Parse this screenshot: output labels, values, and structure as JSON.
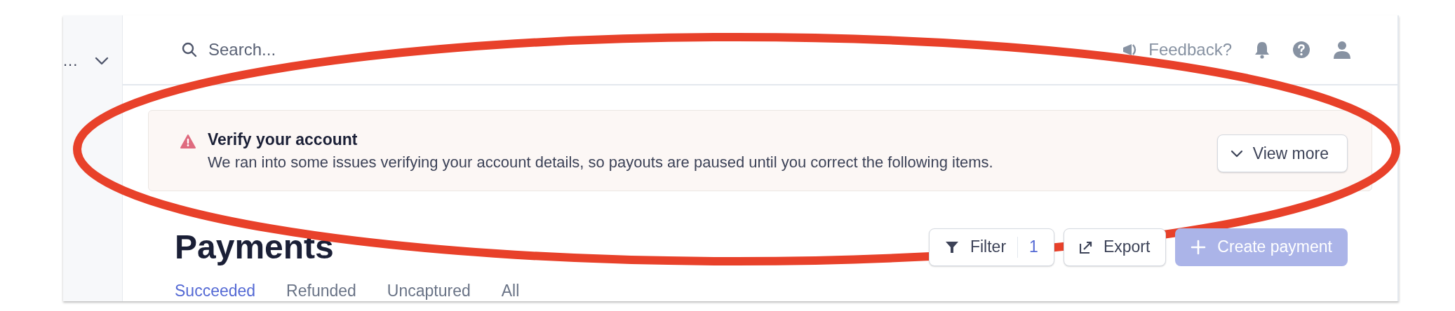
{
  "sidebar": {
    "account_label": "..."
  },
  "header": {
    "search": {
      "placeholder": "Search..."
    },
    "feedback": "Feedback?"
  },
  "banner": {
    "title": "Verify your account",
    "message": "We ran into some issues verifying your account details, so payouts are paused until you correct the following items.",
    "button": "View more"
  },
  "page": {
    "title": "Payments",
    "actions": [
      {
        "kind": "filter",
        "label": "Filter",
        "count": "1",
        "disabled": false
      },
      {
        "kind": "export",
        "label": "Export",
        "disabled": false
      },
      {
        "kind": "create",
        "label": "Create payment",
        "disabled": true
      }
    ],
    "tabs": [
      {
        "label": "Succeeded",
        "selected": true
      },
      {
        "label": "Refunded",
        "selected": false
      },
      {
        "label": "Uncaptured",
        "selected": false
      },
      {
        "label": "All",
        "selected": false
      }
    ]
  }
}
